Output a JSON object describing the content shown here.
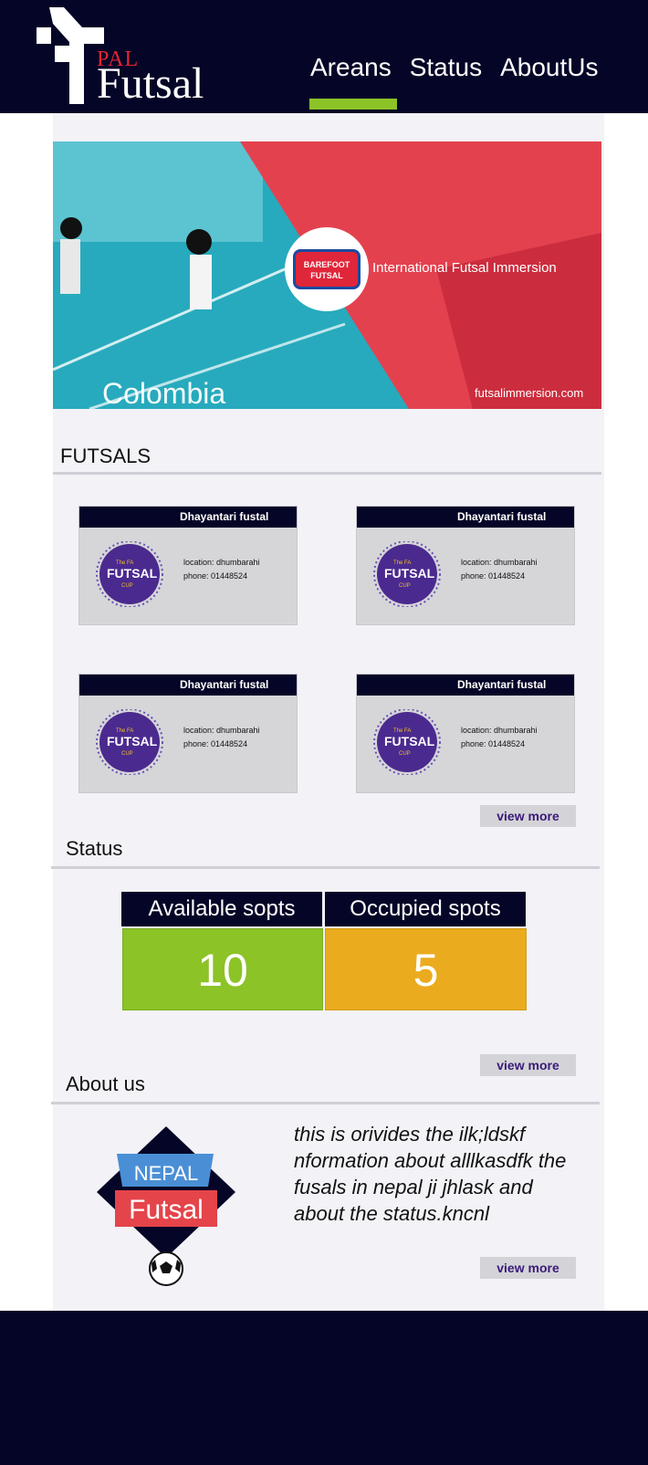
{
  "header": {
    "logo_pal": "PAL",
    "logo_futsal": "Futsal",
    "nav": [
      "Areans",
      "Status",
      "AboutUs"
    ]
  },
  "banner": {
    "tagline": "International Futsal Immersion",
    "country": "Colombia",
    "url": "futsalimmersion.com",
    "badge_text": "BAREFOOT FUTSAL"
  },
  "futsals": {
    "title": "FUTSALS",
    "cards": [
      {
        "name": "Dhayantari fustal",
        "location": "location: dhumbarahi",
        "phone": "phone: 01448524"
      },
      {
        "name": "Dhayantari fustal",
        "location": "location: dhumbarahi",
        "phone": "phone: 01448524"
      },
      {
        "name": "Dhayantari fustal",
        "location": "location: dhumbarahi",
        "phone": "phone: 01448524"
      },
      {
        "name": "Dhayantari fustal",
        "location": "location: dhumbarahi",
        "phone": "phone: 01448524"
      }
    ],
    "logo_text_top": "The FA",
    "logo_text_main": "FUTSAL",
    "logo_text_bottom": "CUP",
    "view_more": "view more"
  },
  "status": {
    "title": "Status",
    "available_label": "Available sopts",
    "occupied_label": "Occupied spots",
    "available_value": "10",
    "occupied_value": "5",
    "view_more": "view more"
  },
  "about": {
    "title": "About us",
    "text": "this is orivides the ilk;ldskf nformation about alllkasdfk the fusals in nepal ji jhlask and about the status.kncnl",
    "logo_nepal": "NEPAL",
    "logo_futsal": "Futsal",
    "view_more": "view more"
  },
  "colors": {
    "navy": "#050527",
    "green": "#8cc327",
    "orange": "#ebab1e",
    "red": "#e0262e",
    "purple": "#3a1a7a"
  }
}
